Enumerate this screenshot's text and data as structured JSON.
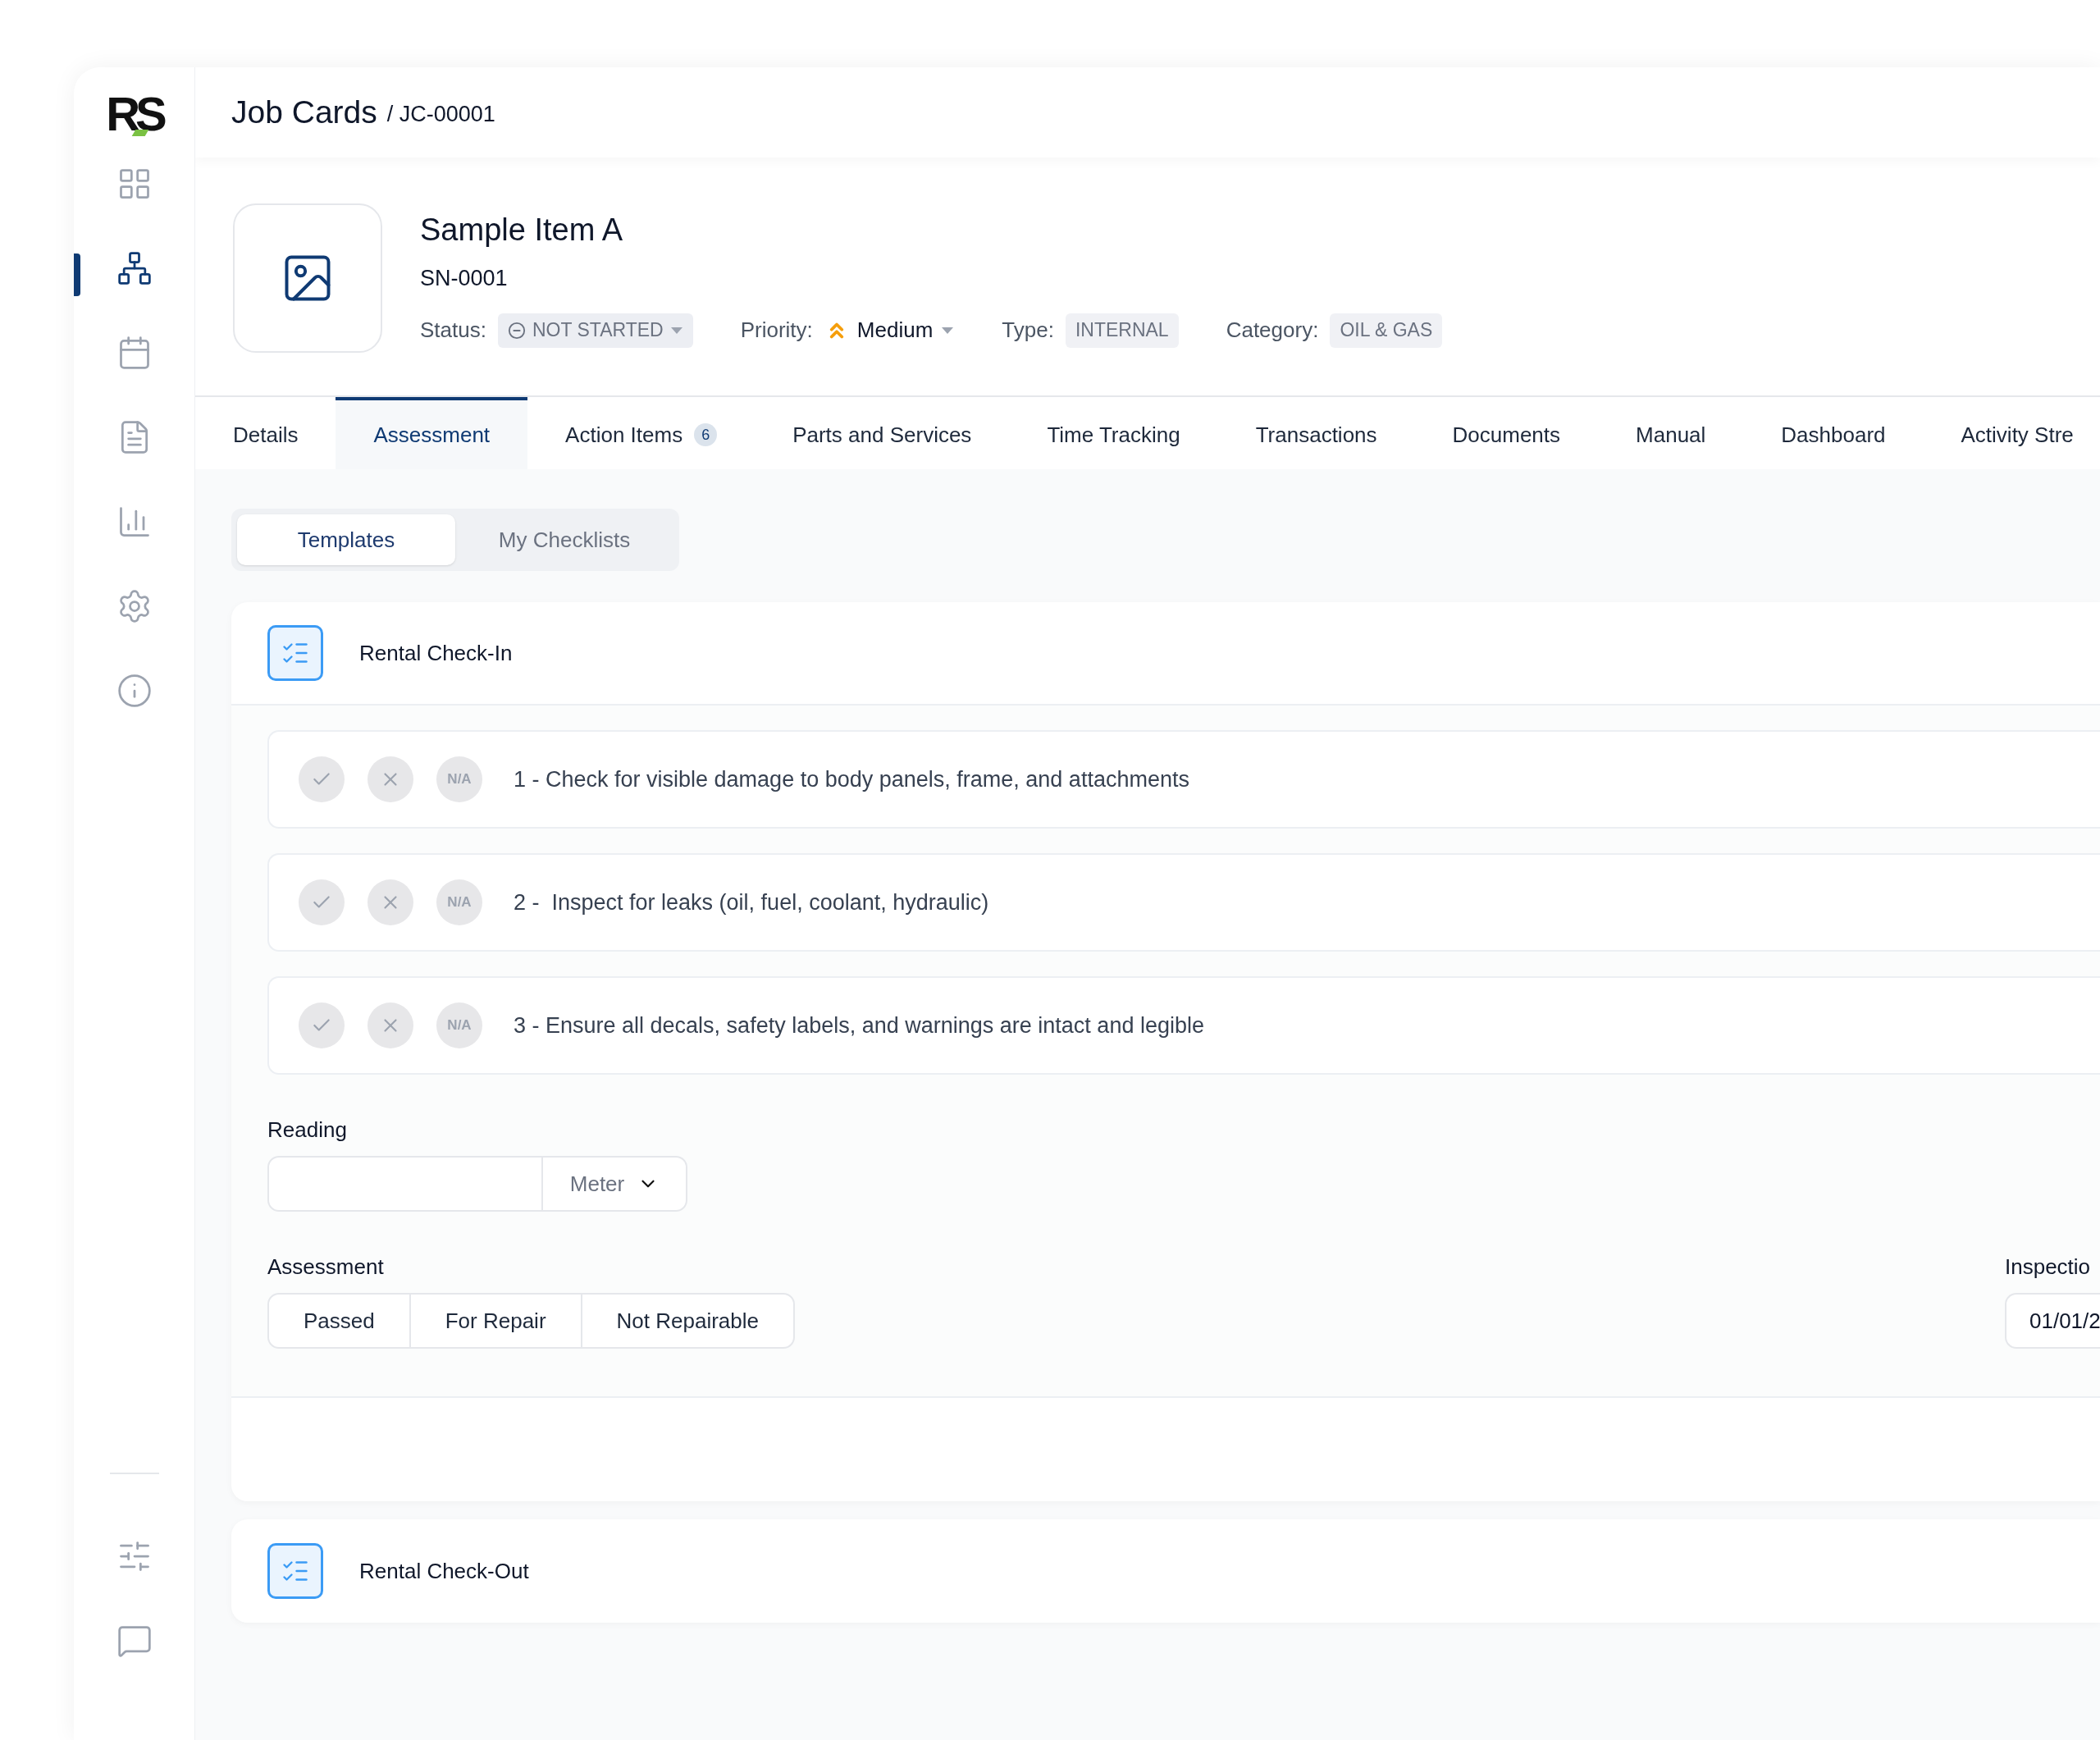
{
  "logo": "RS",
  "sidebar": {
    "items": [
      {
        "kind": "grid",
        "selected": false
      },
      {
        "kind": "org",
        "selected": true
      },
      {
        "kind": "calendar",
        "selected": false
      },
      {
        "kind": "document",
        "selected": false
      },
      {
        "kind": "chart",
        "selected": false
      },
      {
        "kind": "settings",
        "selected": false
      },
      {
        "kind": "info",
        "selected": false
      }
    ],
    "bottom_items": [
      {
        "kind": "sliders",
        "selected": false
      },
      {
        "kind": "chat",
        "selected": false
      }
    ]
  },
  "header": {
    "title": "Job Cards",
    "breadcrumb": "/ JC-00001"
  },
  "item": {
    "name": "Sample Item A",
    "serial": "SN-0001",
    "fields": [
      {
        "kind": "status",
        "label": "Status:",
        "value": "NOT STARTED"
      },
      {
        "kind": "priority",
        "label": "Priority:",
        "value": "Medium"
      },
      {
        "kind": "tag",
        "label": "Type:",
        "value": "INTERNAL"
      },
      {
        "kind": "tag",
        "label": "Category:",
        "value": "OIL & GAS"
      }
    ]
  },
  "tabs": [
    {
      "label": "Details",
      "selected": false
    },
    {
      "label": "Assessment",
      "selected": true
    },
    {
      "label": "Action Items",
      "badge": "6",
      "selected": false
    },
    {
      "label": "Parts and Services",
      "selected": false
    },
    {
      "label": "Time Tracking",
      "selected": false
    },
    {
      "label": "Transactions",
      "selected": false
    },
    {
      "label": "Documents",
      "selected": false
    },
    {
      "label": "Manual",
      "selected": false
    },
    {
      "label": "Dashboard",
      "selected": false
    },
    {
      "label": "Activity Stre",
      "selected": false
    }
  ],
  "subtabs": [
    {
      "label": "Templates",
      "selected": true
    },
    {
      "label": "My Checklists",
      "selected": false
    }
  ],
  "checklists": [
    {
      "title": "Rental Check-In",
      "expanded": true,
      "items": [
        {
          "na": "N/A",
          "text": "1 - Check for visible damage to body panels, frame, and attachments"
        },
        {
          "na": "N/A",
          "text": "2 -  Inspect for leaks (oil, fuel, coolant, hydraulic)"
        },
        {
          "na": "N/A",
          "text": "3 - Ensure all decals, safety labels, and warnings are intact and legible"
        }
      ],
      "reading": {
        "label": "Reading",
        "unit": "Meter"
      },
      "assessment": {
        "label": "Assessment",
        "options": [
          {
            "label": "Passed",
            "selected": false
          },
          {
            "label": "For Repair",
            "selected": false
          },
          {
            "label": "Not Repairable",
            "selected": false
          }
        ]
      },
      "inspection": {
        "label": "Inspectio",
        "value": "01/01/2"
      }
    },
    {
      "title": "Rental Check-Out",
      "expanded": false
    }
  ]
}
